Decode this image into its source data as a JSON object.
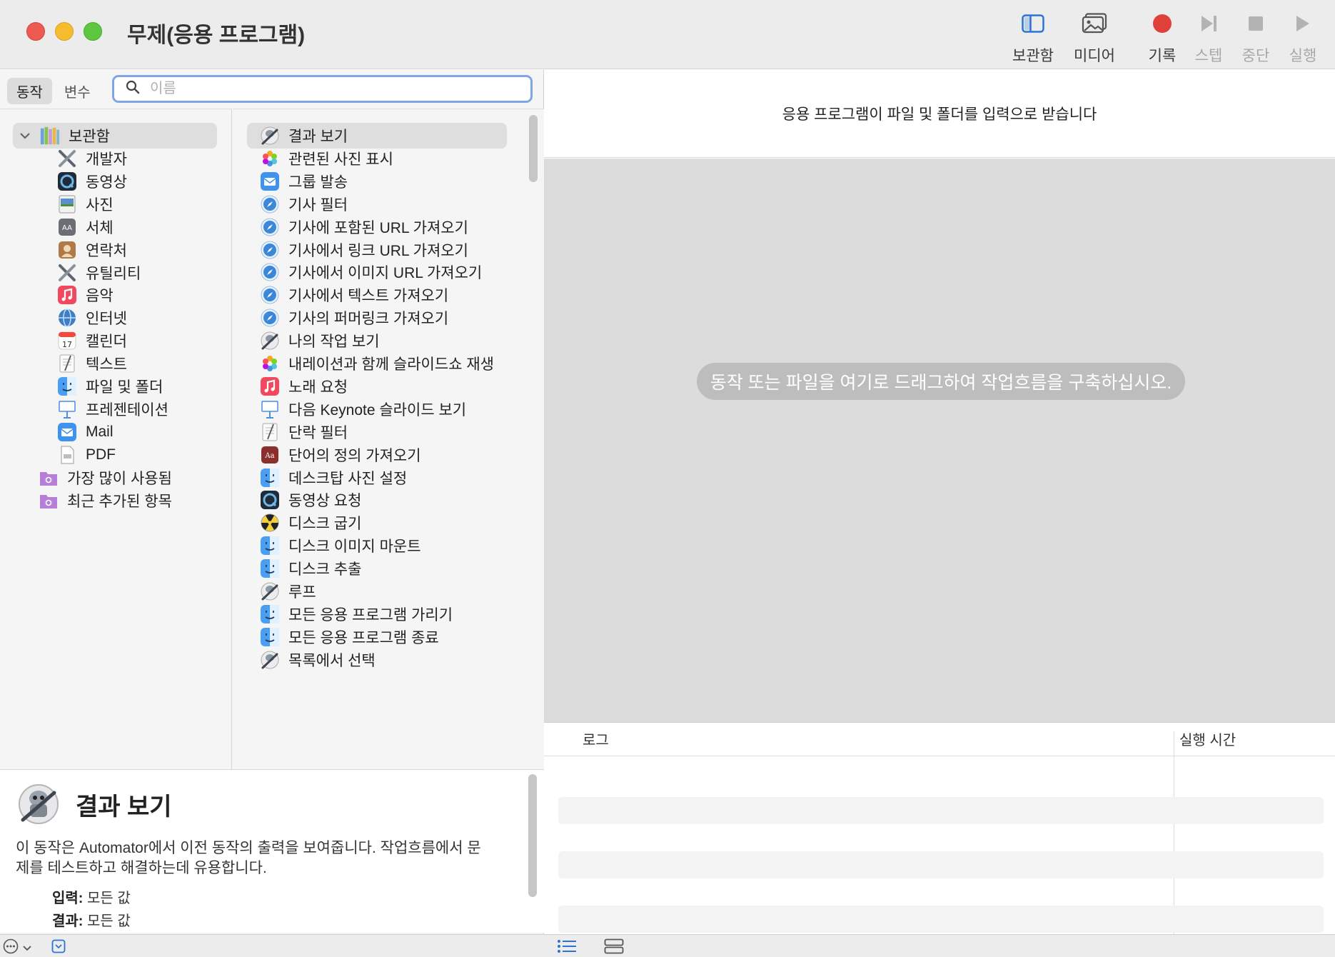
{
  "window": {
    "title": "무제(응용 프로그램)"
  },
  "toolbar": {
    "buttons": [
      {
        "label": "보관함",
        "icon": "library-sidebar-icon",
        "enabled": true
      },
      {
        "label": "미디어",
        "icon": "media-photos-icon",
        "enabled": true
      },
      {
        "label": "기록",
        "icon": "record-icon",
        "enabled": true
      },
      {
        "label": "스텝",
        "icon": "step-icon",
        "enabled": false
      },
      {
        "label": "중단",
        "icon": "stop-icon",
        "enabled": false
      },
      {
        "label": "실행",
        "icon": "run-icon",
        "enabled": false
      }
    ],
    "colors": {
      "record": "#e0403a",
      "disabled": "#b3b3b3",
      "accent": "#2b73d6"
    }
  },
  "library": {
    "tabs": {
      "actions": "동작",
      "variables": "변수",
      "active": "동작"
    },
    "search": {
      "placeholder": "이름",
      "value": ""
    },
    "root": {
      "label": "보관함",
      "expanded": true
    },
    "categories": [
      {
        "label": "개발자",
        "icon": "tools-icon"
      },
      {
        "label": "동영상",
        "icon": "quicktime-icon"
      },
      {
        "label": "사진",
        "icon": "preview-photo-icon"
      },
      {
        "label": "서체",
        "icon": "font-book-icon"
      },
      {
        "label": "연락처",
        "icon": "contacts-icon"
      },
      {
        "label": "유틸리티",
        "icon": "tools-icon"
      },
      {
        "label": "음악",
        "icon": "music-icon"
      },
      {
        "label": "인터넷",
        "icon": "internet-globe-icon"
      },
      {
        "label": "캘린더",
        "icon": "calendar-icon"
      },
      {
        "label": "텍스트",
        "icon": "textedit-icon"
      },
      {
        "label": "파일 및 폴더",
        "icon": "finder-icon"
      },
      {
        "label": "프레젠테이션",
        "icon": "keynote-icon"
      },
      {
        "label": "Mail",
        "icon": "mail-icon"
      },
      {
        "label": "PDF",
        "icon": "pdf-icon"
      }
    ],
    "smart_groups": [
      {
        "label": "가장 많이 사용됨",
        "icon": "smart-folder-icon"
      },
      {
        "label": "최근 추가된 항목",
        "icon": "smart-folder-icon"
      }
    ]
  },
  "actions": {
    "selected": "결과 보기",
    "items": [
      {
        "label": "결과 보기",
        "icon": "automator-icon"
      },
      {
        "label": "관련된 사진 표시",
        "icon": "photos-icon"
      },
      {
        "label": "그룹 발송",
        "icon": "mail-icon"
      },
      {
        "label": "기사 필터",
        "icon": "safari-icon"
      },
      {
        "label": "기사에 포함된 URL 가져오기",
        "icon": "safari-icon"
      },
      {
        "label": "기사에서 링크 URL 가져오기",
        "icon": "safari-icon"
      },
      {
        "label": "기사에서 이미지 URL 가져오기",
        "icon": "safari-icon"
      },
      {
        "label": "기사에서 텍스트 가져오기",
        "icon": "safari-icon"
      },
      {
        "label": "기사의 퍼머링크 가져오기",
        "icon": "safari-icon"
      },
      {
        "label": "나의 작업 보기",
        "icon": "automator-icon"
      },
      {
        "label": "내레이션과 함께 슬라이드쇼 재생",
        "icon": "photos-icon"
      },
      {
        "label": "노래 요청",
        "icon": "music-icon"
      },
      {
        "label": "다음 Keynote 슬라이드 보기",
        "icon": "keynote-icon"
      },
      {
        "label": "단락 필터",
        "icon": "textedit-icon"
      },
      {
        "label": "단어의 정의 가져오기",
        "icon": "dictionary-icon"
      },
      {
        "label": "데스크탑 사진 설정",
        "icon": "finder-icon"
      },
      {
        "label": "동영상 요청",
        "icon": "quicktime-icon"
      },
      {
        "label": "디스크 굽기",
        "icon": "burn-disc-icon"
      },
      {
        "label": "디스크 이미지 마운트",
        "icon": "finder-icon"
      },
      {
        "label": "디스크 추출",
        "icon": "finder-icon"
      },
      {
        "label": "루프",
        "icon": "automator-icon"
      },
      {
        "label": "모든 응용 프로그램 가리기",
        "icon": "finder-icon"
      },
      {
        "label": "모든 응용 프로그램 종료",
        "icon": "finder-icon"
      },
      {
        "label": "목록에서 선택",
        "icon": "automator-icon"
      }
    ]
  },
  "description": {
    "title": "결과 보기",
    "text": "이 동작은 Automator에서 이전 동작의 출력을 보여줍니다. 작업흐름에서 문제를 테스트하고 해결하는데 유용합니다.",
    "input_label": "입력:",
    "input_value": "모든 값",
    "result_label": "결과:",
    "result_value": "모든 값"
  },
  "workflow": {
    "input_banner": "응용 프로그램이 파일 및 폴더를 입력으로 받습니다",
    "drop_hint": "동작 또는 파일을 여기로 드래그하여 작업흐름을 구축하십시오."
  },
  "log": {
    "col_log": "로그",
    "col_duration": "실행 시간"
  }
}
